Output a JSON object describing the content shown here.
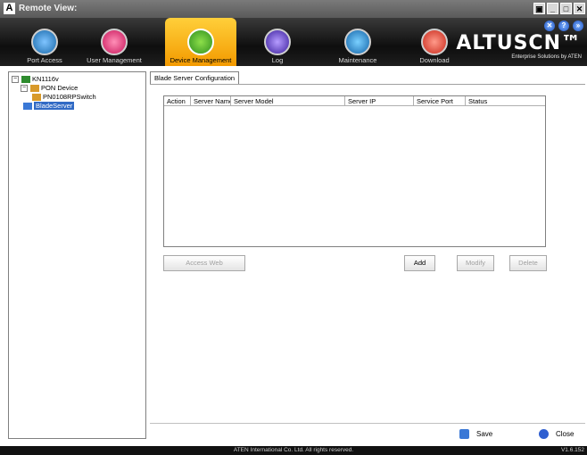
{
  "window": {
    "title": "Remote View:",
    "buttons": [
      "▣",
      "_",
      "□",
      "✕"
    ]
  },
  "toolbar": {
    "items": [
      {
        "label": "Port Access",
        "icon": "port-access-icon"
      },
      {
        "label": "User Management",
        "icon": "user-management-icon"
      },
      {
        "label": "Device Management",
        "icon": "device-management-icon",
        "active": true
      },
      {
        "label": "Log",
        "icon": "log-icon"
      },
      {
        "label": "Maintenance",
        "icon": "maintenance-icon"
      },
      {
        "label": "Download",
        "icon": "download-icon"
      }
    ],
    "brand": "ALTUSCN™",
    "brand_tagline": "Enterprise Solutions by ATEN",
    "top_icons": [
      "✕",
      "?",
      "»"
    ]
  },
  "tree": {
    "root": "KN1116v",
    "pon_device": "PON Device",
    "pon_child": "PN0108RPSwitch",
    "blade_server": "BladeServer"
  },
  "tab": {
    "label": "Blade Server Configuration"
  },
  "table": {
    "columns": [
      "Action",
      "Server Name",
      "Server Model",
      "Server IP",
      "Service Port",
      "Status"
    ],
    "rows": []
  },
  "buttons": {
    "access_web": "Access Web",
    "add": "Add",
    "modify": "Modify",
    "delete": "Delete",
    "save": "Save",
    "close": "Close"
  },
  "status": {
    "copyright": "ATEN International Co. Ltd. All rights reserved.",
    "version": "V1.6.152"
  },
  "colors": {
    "active_tab": "#f39a00",
    "selection": "#316ac5"
  }
}
